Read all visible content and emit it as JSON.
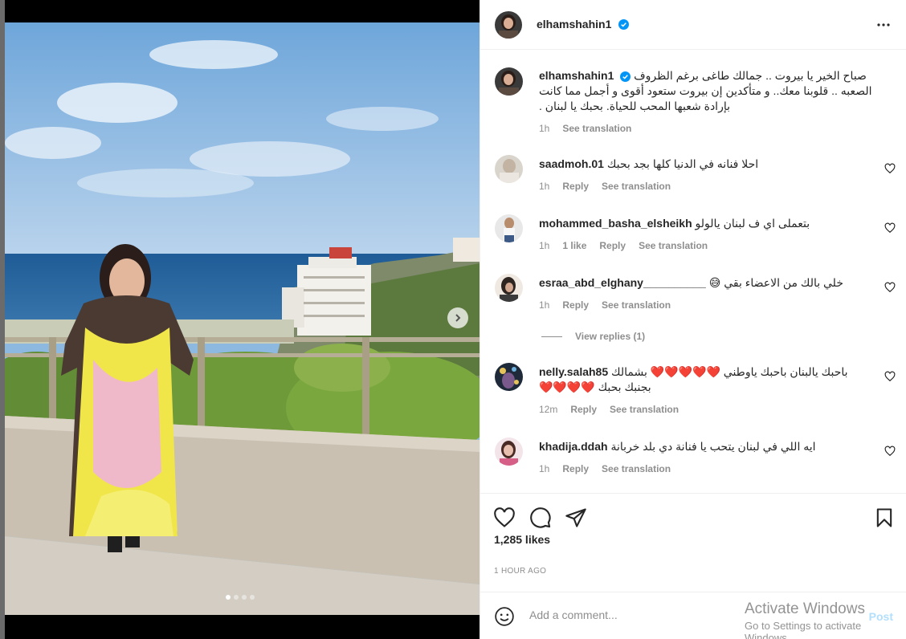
{
  "post": {
    "username": "elhamshahin1",
    "caption_username": "elhamshahin1",
    "caption_text": "صباح الخير يا بيروت .. جمالك طاغى برغم الظروف الصعبه .. قلوبنا معك.. و متأكدين إن بيروت ستعود أقوى و أجمل مما كانت بإرادة شعبها المحب للحياة. بحبك يا لبنان .",
    "caption_time": "1h",
    "caption_translation": "See translation",
    "likes": "1,285 likes",
    "time_ago": "1 HOUR AGO"
  },
  "comments": [
    {
      "username": "saadmoh.01",
      "text": "احلا فنانه في الدنيا كلها بجد بحبك",
      "time": "1h",
      "reply": "Reply",
      "translation": "See translation"
    },
    {
      "username": "mohammed_basha_elsheikh",
      "text": "بتعملى اي ف لبنان يالولو",
      "time": "1h",
      "likes": "1 like",
      "reply": "Reply",
      "translation": "See translation"
    },
    {
      "username": "esraa_abd_elghany__________",
      "text": "خلي بالك من الاعضاء بقي 😅",
      "time": "1h",
      "reply": "Reply",
      "translation": "See translation"
    },
    {
      "username": "nelly.salah85",
      "text": "باحبك يالبنان باحبك ياوطني ❤️❤️❤️❤️❤️ بشمالك بجنبك بحبك ❤️❤️❤️❤️",
      "time": "12m",
      "reply": "Reply",
      "translation": "See translation"
    },
    {
      "username": "khadija.ddah",
      "text": "ايه اللي في لبنان يتحب يا فنانة دي بلد خربانة",
      "time": "1h",
      "reply": "Reply",
      "translation": "See translation"
    }
  ],
  "view_replies": "View replies (1)",
  "add_comment": {
    "placeholder": "Add a comment...",
    "post_label": "Post"
  },
  "watermark": {
    "line1": "Activate Windows",
    "line2": "Go to Settings to activate Windows."
  },
  "colors": {
    "verified": "#0095f6",
    "post_button": "#b2dffc",
    "muted": "#8e8e8e"
  }
}
